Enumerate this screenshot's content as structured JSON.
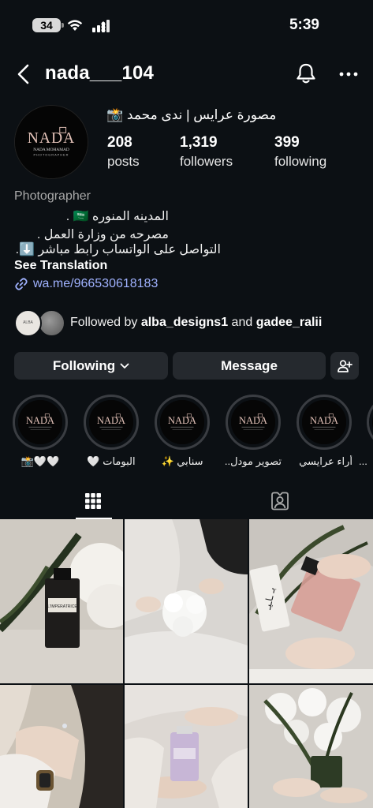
{
  "status_bar": {
    "battery": "34",
    "time": "5:39"
  },
  "nav": {
    "username": "nada___104"
  },
  "profile": {
    "full_name": "مصورة عرايس | ندى محمد 📸",
    "avatar_text": {
      "brand": "NADA",
      "name": "NADA MOHAMAD",
      "role": "PHOTOGRAPHER"
    },
    "stats": [
      {
        "value": "208",
        "label": "posts"
      },
      {
        "value": "1,319",
        "label": "followers"
      },
      {
        "value": "399",
        "label": "following"
      }
    ]
  },
  "bio": {
    "category": "Photographer",
    "lines": [
      "المدينه المنوره 🇸🇦 .",
      "مصرحه من وزارة العمل .",
      "التواصل على الواتساب رابط مباشر ⬇️."
    ],
    "see_translation": "See Translation",
    "link": "wa.me/966530618183"
  },
  "followed_by": {
    "prefix": "Followed by ",
    "user1": "alba_designs1",
    "connector": " and ",
    "user2": "gadee_ralii",
    "avatar1_text": "ALBA"
  },
  "buttons": {
    "following": "Following",
    "message": "Message"
  },
  "highlights": [
    {
      "label": "🤍🤍📸"
    },
    {
      "label": "البومات 🤍"
    },
    {
      "label": "سنابي ✨"
    },
    {
      "label": "تصوير مودل..."
    },
    {
      "label": "أراء عرايسي 🤍."
    },
    {
      "label": "..."
    }
  ],
  "grid_photos": [
    {
      "text": "L'IMPERATRICE"
    },
    {
      "text": ""
    },
    {
      "text": "بـ ـاـيـ"
    },
    {
      "text": ""
    },
    {
      "text": ""
    },
    {
      "text": ""
    }
  ]
}
